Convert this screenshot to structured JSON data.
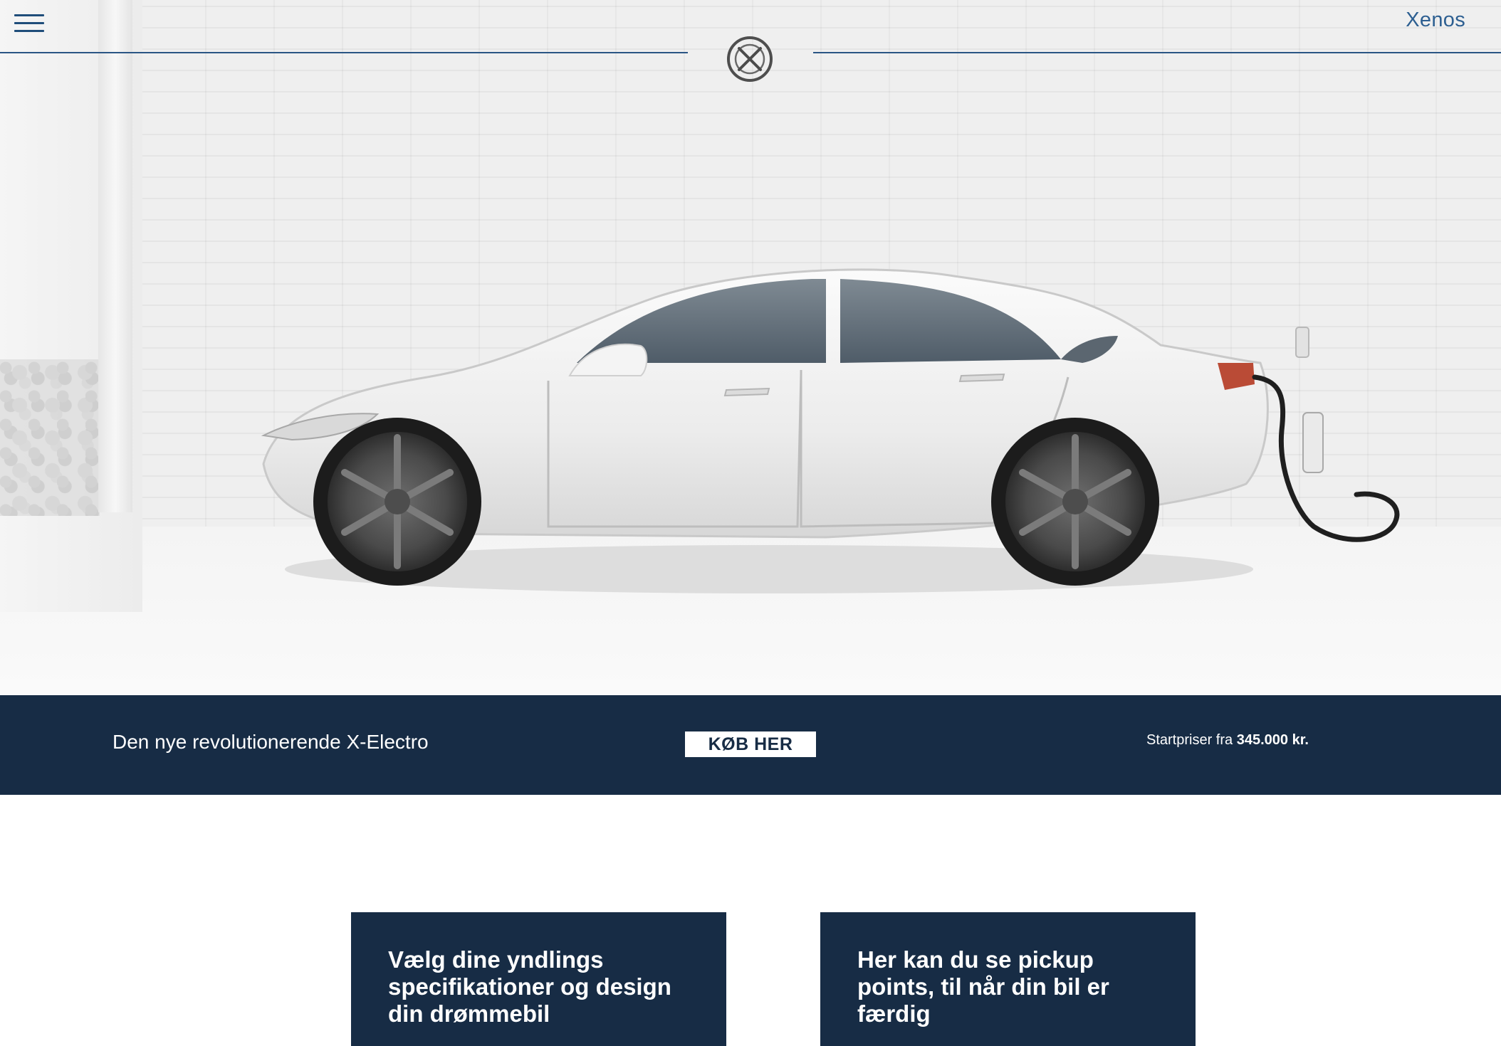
{
  "header": {
    "brand": "Xenos",
    "menu_icon": "hamburger-menu-icon",
    "logo_icon": "x-circle-logo-icon"
  },
  "hero": {
    "image": "white-electric-sedan-charging"
  },
  "promo": {
    "text": "Den nye revolutionerende X-Electro",
    "button_label": "KØB HER",
    "price_prefix": "Startpriser fra",
    "price_amount": "345.000 kr."
  },
  "cards": [
    {
      "title": "Vælg dine yndlings specifikationer og design din drømmebil"
    },
    {
      "title": "Her kan du se pickup points, til når din bil er færdig"
    }
  ],
  "colors": {
    "navy": "#172c45",
    "accent_blue": "#2d5f91",
    "white": "#ffffff"
  }
}
